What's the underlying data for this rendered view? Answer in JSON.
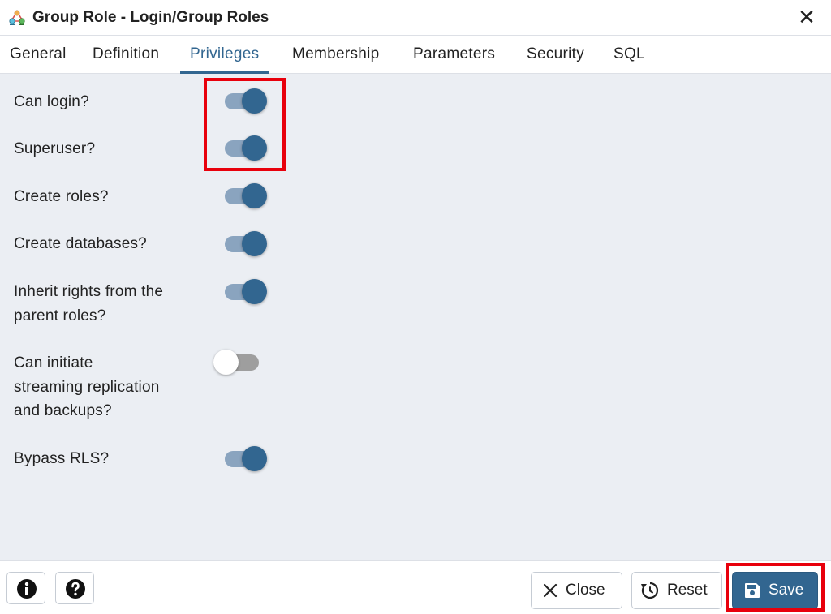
{
  "dialog": {
    "title": "Group Role - Login/Group Roles",
    "app_icon": "group-role-icon",
    "close_icon": "close-icon"
  },
  "tabs": [
    {
      "label": "General"
    },
    {
      "label": "Definition"
    },
    {
      "label": "Privileges"
    },
    {
      "label": "Membership"
    },
    {
      "label": "Parameters"
    },
    {
      "label": "Security"
    },
    {
      "label": "SQL"
    }
  ],
  "active_tab": "Privileges",
  "privileges": [
    {
      "label": "Can login?",
      "enabled": true
    },
    {
      "label": "Superuser?",
      "enabled": true
    },
    {
      "label": "Create roles?",
      "enabled": true
    },
    {
      "label": "Create databases?",
      "enabled": true
    },
    {
      "label_line1": "Inherit rights from the",
      "label_line2": "parent roles?",
      "enabled": true
    },
    {
      "label_line1": "Can initiate",
      "label_line2": "streaming replication",
      "label_line3": "and backups?",
      "enabled": false
    },
    {
      "label": "Bypass RLS?",
      "enabled": true
    }
  ],
  "footer": {
    "info_icon": "info-icon",
    "help_icon": "help-icon",
    "close_label": "Close",
    "reset_label": "Reset",
    "save_label": "Save"
  },
  "colors": {
    "accent": "#326690",
    "highlight": "#e8000c",
    "content_bg": "#ebeef3"
  }
}
